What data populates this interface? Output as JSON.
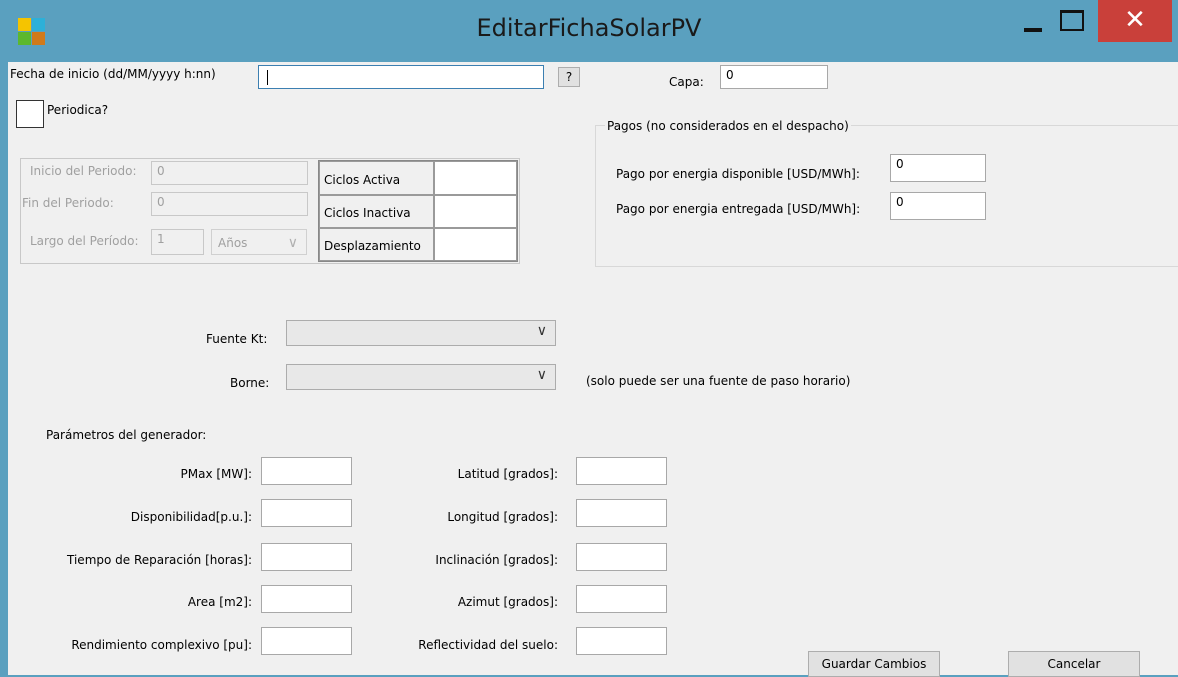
{
  "window": {
    "title": "EditarFichaSolarPV",
    "close_glyph": "✕"
  },
  "top": {
    "fecha_label": "Fecha de inicio (dd/MM/yyyy h:nn)",
    "fecha_value": "",
    "help_button": "?",
    "capa_label": "Capa:",
    "capa_value": "0",
    "periodica_label": "Periodica?"
  },
  "periodo": {
    "inicio_label": "Inicio del Periodo:",
    "inicio_value": "0",
    "fin_label": "Fin del Periodo:",
    "fin_value": "0",
    "largo_label": "Largo del Período:",
    "largo_value": "1",
    "unidad_value": "Años",
    "grid_rows": [
      {
        "label": "Ciclos Activa",
        "value": ""
      },
      {
        "label": "Ciclos Inactiva",
        "value": ""
      },
      {
        "label": "Desplazamiento",
        "value": ""
      }
    ]
  },
  "pagos": {
    "title": "Pagos (no considerados en el despacho)",
    "disponible_label": "Pago por energia disponible [USD/MWh]:",
    "disponible_value": "0",
    "entregada_label": "Pago por energia entregada  [USD/MWh]:",
    "entregada_value": "0"
  },
  "fuentes": {
    "fuente_kt_label": "Fuente Kt:",
    "fuente_kt_value": "",
    "borne_label": "Borne:",
    "borne_value": "",
    "borne_note": "(solo puede ser una fuente de paso horario)"
  },
  "generador": {
    "section_label": "Parámetros del generador:",
    "left": [
      {
        "label": "PMax [MW]:",
        "value": ""
      },
      {
        "label": "Disponibilidad[p.u.]:",
        "value": ""
      },
      {
        "label": "Tiempo de Reparación [horas]:",
        "value": ""
      },
      {
        "label": "Area [m2]:",
        "value": ""
      },
      {
        "label": "Rendimiento complexivo [pu]:",
        "value": ""
      }
    ],
    "right": [
      {
        "label": "Latitud [grados]:",
        "value": ""
      },
      {
        "label": "Longitud [grados]:",
        "value": ""
      },
      {
        "label": "Inclinación [grados]:",
        "value": ""
      },
      {
        "label": "Azimut [grados]:",
        "value": ""
      },
      {
        "label": "Reflectividad del suelo:",
        "value": ""
      }
    ]
  },
  "actions": {
    "save_label": "Guardar Cambios",
    "cancel_label": "Cancelar"
  },
  "colors": {
    "titlebar": "#5aa0bf",
    "close": "#c9403a",
    "client": "#f0f0f0"
  }
}
